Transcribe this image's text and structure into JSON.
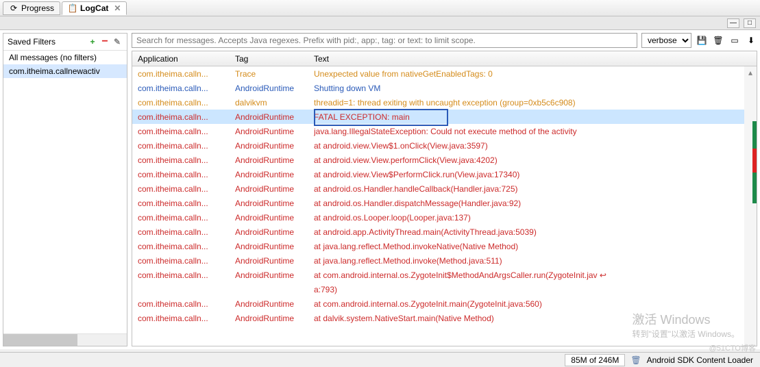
{
  "tabs": [
    {
      "icon": "⟳",
      "label": "Progress"
    },
    {
      "icon": "📋",
      "label": "LogCat"
    }
  ],
  "filters": {
    "title": "Saved Filters",
    "items": [
      {
        "label": "All messages (no filters)",
        "selected": false
      },
      {
        "label": "com.itheima.callnewactiv",
        "selected": true
      }
    ]
  },
  "search": {
    "placeholder": "Search for messages. Accepts Java regexes. Prefix with pid:, app:, tag: or text: to limit scope.",
    "level": "verbose"
  },
  "columns": {
    "app": "Application",
    "tag": "Tag",
    "text": "Text"
  },
  "rows": [
    {
      "cls": "warn",
      "app": "com.itheima.calln...",
      "tag": "Trace",
      "text": "Unexpected value from nativeGetEnabledTags: 0"
    },
    {
      "cls": "debug",
      "app": "com.itheima.calln...",
      "tag": "AndroidRuntime",
      "text": "Shutting down VM"
    },
    {
      "cls": "dalvikvm",
      "app": "com.itheima.calln...",
      "tag": "dalvikvm",
      "text": "threadid=1: thread exiting with uncaught exception (group=0xb5c6c908)"
    },
    {
      "cls": "error selected",
      "app": "com.itheima.calln...",
      "tag": "AndroidRuntime",
      "text": "FATAL EXCEPTION: main"
    },
    {
      "cls": "error",
      "app": "com.itheima.calln...",
      "tag": "AndroidRuntime",
      "text": "java.lang.IllegalStateException: Could not execute method of the activity"
    },
    {
      "cls": "error",
      "app": "com.itheima.calln...",
      "tag": "AndroidRuntime",
      "text": "at android.view.View$1.onClick(View.java:3597)"
    },
    {
      "cls": "error",
      "app": "com.itheima.calln...",
      "tag": "AndroidRuntime",
      "text": "at android.view.View.performClick(View.java:4202)"
    },
    {
      "cls": "error",
      "app": "com.itheima.calln...",
      "tag": "AndroidRuntime",
      "text": "at android.view.View$PerformClick.run(View.java:17340)"
    },
    {
      "cls": "error",
      "app": "com.itheima.calln...",
      "tag": "AndroidRuntime",
      "text": "at android.os.Handler.handleCallback(Handler.java:725)"
    },
    {
      "cls": "error",
      "app": "com.itheima.calln...",
      "tag": "AndroidRuntime",
      "text": "at android.os.Handler.dispatchMessage(Handler.java:92)"
    },
    {
      "cls": "error",
      "app": "com.itheima.calln...",
      "tag": "AndroidRuntime",
      "text": "at android.os.Looper.loop(Looper.java:137)"
    },
    {
      "cls": "error",
      "app": "com.itheima.calln...",
      "tag": "AndroidRuntime",
      "text": "at android.app.ActivityThread.main(ActivityThread.java:5039)"
    },
    {
      "cls": "error",
      "app": "com.itheima.calln...",
      "tag": "AndroidRuntime",
      "text": "at java.lang.reflect.Method.invokeNative(Native Method)"
    },
    {
      "cls": "error",
      "app": "com.itheima.calln...",
      "tag": "AndroidRuntime",
      "text": "at java.lang.reflect.Method.invoke(Method.java:511)"
    },
    {
      "cls": "error",
      "app": "com.itheima.calln...",
      "tag": "AndroidRuntime",
      "text": "at com.android.internal.os.ZygoteInit$MethodAndArgsCaller.run(ZygoteInit.jav ↩"
    },
    {
      "cls": "error",
      "app": "",
      "tag": "",
      "text": "a:793)"
    },
    {
      "cls": "error",
      "app": "com.itheima.calln...",
      "tag": "AndroidRuntime",
      "text": "at com.android.internal.os.ZygoteInit.main(ZygoteInit.java:560)"
    },
    {
      "cls": "error",
      "app": "com.itheima.calln...",
      "tag": "AndroidRuntime",
      "text": "at dalvik.system.NativeStart.main(Native Method)"
    }
  ],
  "watermark": {
    "line1": "激活 Windows",
    "line2": "转到\"设置\"以激活 Windows。"
  },
  "blog": "@51CTO博客",
  "status": {
    "mem": "85M of 246M",
    "loader": "Android SDK Content Loader"
  }
}
